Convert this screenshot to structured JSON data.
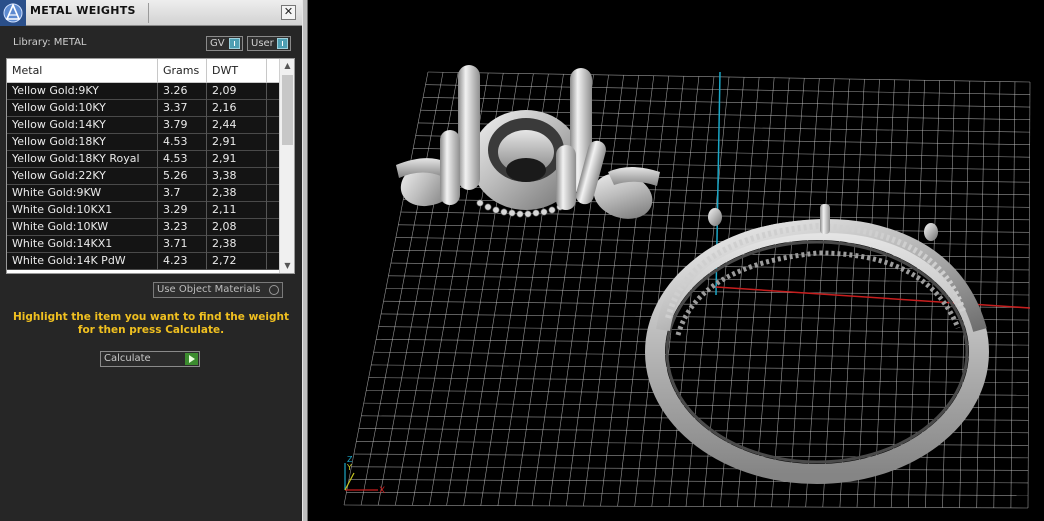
{
  "window": {
    "title": "METAL WEIGHTS",
    "close_glyph": "✕"
  },
  "library": {
    "label": "Library: METAL",
    "toggles": [
      {
        "label": "GV"
      },
      {
        "label": "User"
      }
    ]
  },
  "table": {
    "columns": [
      "Metal",
      "Grams",
      "DWT"
    ],
    "rows": [
      [
        "Yellow Gold:9KY",
        "3.26",
        "2,09"
      ],
      [
        "Yellow Gold:10KY",
        "3.37",
        "2,16"
      ],
      [
        "Yellow Gold:14KY",
        "3.79",
        "2,44"
      ],
      [
        "Yellow Gold:18KY",
        "4.53",
        "2,91"
      ],
      [
        "Yellow Gold:18KY Royal",
        "4.53",
        "2,91"
      ],
      [
        "Yellow Gold:22KY",
        "5.26",
        "3,38"
      ],
      [
        "White Gold:9KW",
        "3.7",
        "2,38"
      ],
      [
        "White Gold:10KX1",
        "3.29",
        "2,11"
      ],
      [
        "White Gold:10KW",
        "3.23",
        "2,08"
      ],
      [
        "White Gold:14KX1",
        "3.71",
        "2,38"
      ],
      [
        "White Gold:14K PdW",
        "4.23",
        "2,72"
      ]
    ]
  },
  "options": {
    "use_object_materials": "Use Object Materials"
  },
  "instruction": "Highlight the item you want to find the weight for then press Calculate.",
  "calculate_button": "Calculate",
  "viewport": {
    "axis_x_label": "X",
    "axis_y_label": "Y",
    "axis_z_label": "Z"
  },
  "colors": {
    "instruction_text": "#f0c020",
    "grid_line": "#c8c8c8",
    "axis_red": "#cc2020",
    "axis_cyan": "#20a8c8"
  }
}
